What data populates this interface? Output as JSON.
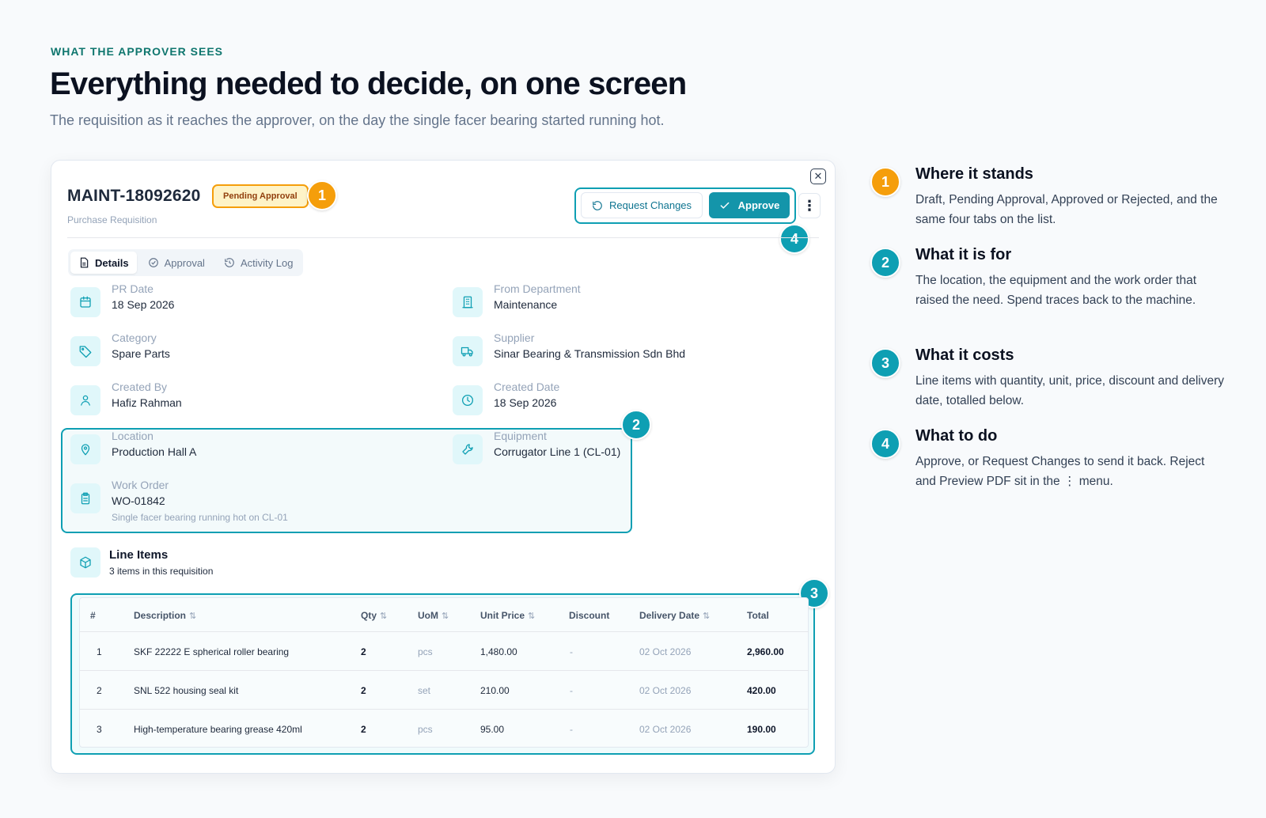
{
  "hero": {
    "eyebrow": "WHAT THE APPROVER SEES",
    "headline": "Everything needed to decide, on one screen",
    "subline": "The requisition as it reaches the approver, on the day the single facer bearing started running hot."
  },
  "requisition": {
    "number": "MAINT-18092620",
    "status": "Pending Approval",
    "doc_type": "Purchase Requisition",
    "actions": {
      "request_changes": "Request Changes",
      "approve": "Approve",
      "more": "⋮",
      "close": "✕"
    },
    "tabs": [
      "Details",
      "Approval",
      "Activity Log"
    ],
    "fields": {
      "pr_date": {
        "label": "PR Date",
        "value": "18 Sep 2026"
      },
      "from_department": {
        "label": "From Department",
        "value": "Maintenance"
      },
      "category": {
        "label": "Category",
        "value": "Spare Parts"
      },
      "supplier": {
        "label": "Supplier",
        "value": "Sinar Bearing & Transmission Sdn Bhd"
      },
      "created_by": {
        "label": "Created By",
        "value": "Hafiz Rahman"
      },
      "created_date": {
        "label": "Created Date",
        "value": "18 Sep 2026"
      },
      "location": {
        "label": "Location",
        "value": "Production Hall A"
      },
      "equipment": {
        "label": "Equipment",
        "value": "Corrugator Line 1 (CL-01)"
      },
      "work_order": {
        "label": "Work Order",
        "value": "WO-01842",
        "note": "Single facer bearing running hot on CL-01"
      }
    },
    "line_items": {
      "title": "Line Items",
      "subtitle": "3 items in this requisition",
      "sort_glyph": "⇅",
      "columns": [
        "#",
        "Description",
        "Qty",
        "UoM",
        "Unit Price",
        "Discount",
        "Delivery Date",
        "Total"
      ],
      "rows": [
        {
          "n": "1",
          "description": "SKF 22222 E spherical roller bearing",
          "qty": "2",
          "uom": "pcs",
          "unit_price": "1,480.00",
          "discount": "-",
          "delivery": "02 Oct 2026",
          "total": "2,960.00"
        },
        {
          "n": "2",
          "description": "SNL 522 housing seal kit",
          "qty": "2",
          "uom": "set",
          "unit_price": "210.00",
          "discount": "-",
          "delivery": "02 Oct 2026",
          "total": "420.00"
        },
        {
          "n": "3",
          "description": "High-temperature bearing grease 420ml",
          "qty": "2",
          "uom": "pcs",
          "unit_price": "95.00",
          "discount": "-",
          "delivery": "02 Oct 2026",
          "total": "190.00"
        }
      ]
    }
  },
  "markers": [
    "1",
    "2",
    "3",
    "4"
  ],
  "legend": [
    {
      "n": "1",
      "title": "Where it stands",
      "body": "Draft, Pending Approval, Approved or Rejected, and the same four tabs on the list."
    },
    {
      "n": "2",
      "title": "What it is for",
      "body": "The location, the equipment and the work order that raised the need. Spend traces back to the machine."
    },
    {
      "n": "3",
      "title": "What it costs",
      "body": "Line items with quantity, unit, price, discount and delivery date, totalled below."
    },
    {
      "n": "4",
      "title": "What to do",
      "body": "Approve, or Request Changes to send it back. Reject and Preview PDF sit in the ⋮ menu."
    }
  ],
  "colors": {
    "accent": "#0e9fb3",
    "status_marker": "#f59e0b",
    "approve": "#1495aa"
  }
}
